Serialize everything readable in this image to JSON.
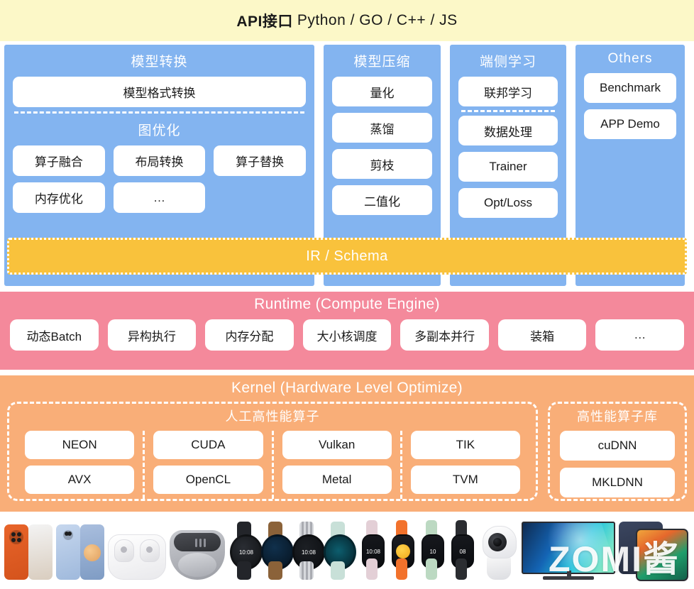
{
  "api_banner": {
    "bold_label": "API接口",
    "languages": "Python / GO / C++ / JS"
  },
  "frontend": {
    "columns": [
      {
        "title": "模型转换",
        "full_item": "模型格式转换",
        "sub_title": "图优化",
        "row1": [
          "算子融合",
          "布局转换",
          "算子替换"
        ],
        "row2": [
          "内存优化",
          "…"
        ]
      },
      {
        "title": "模型压缩",
        "items": [
          "量化",
          "蒸馏",
          "剪枝",
          "二值化"
        ]
      },
      {
        "title": "端侧学习",
        "top_item": "联邦学习",
        "items": [
          "数据处理",
          "Trainer",
          "Opt/Loss"
        ]
      },
      {
        "title": "Others",
        "items": [
          "Benchmark",
          "APP Demo"
        ]
      }
    ]
  },
  "ir_band": {
    "label": "IR / Schema"
  },
  "runtime": {
    "title": "Runtime (Compute Engine)",
    "items": [
      "动态Batch",
      "异构执行",
      "内存分配",
      "大小核调度",
      "多副本并行",
      "装箱",
      "…"
    ]
  },
  "kernel": {
    "title": "Kernel (Hardware Level Optimize)",
    "manual": {
      "title": "人工高性能算子",
      "groups": [
        [
          "NEON",
          "AVX"
        ],
        [
          "CUDA",
          "OpenCL"
        ],
        [
          "Vulkan",
          "Metal"
        ],
        [
          "TIK",
          "TVM"
        ]
      ]
    },
    "library": {
      "title": "高性能算子库",
      "items": [
        "cuDNN",
        "MKLDNN"
      ]
    }
  },
  "devices": {
    "labels": [
      "phone-orange",
      "phone-blue",
      "earbuds-white-case",
      "earbuds-gray-case",
      "smartwatch-black",
      "smartwatch-brown",
      "smartwatch-steel",
      "smartwatch-mint",
      "fitness-band-pink",
      "fitness-band-orange",
      "fitness-band-green",
      "fitness-band-black",
      "security-camera",
      "smart-tv",
      "tablet"
    ],
    "watch_time_1": "10:08",
    "watch_time_2": "10:08",
    "band_time_1": "10:08",
    "band_time_2": "10",
    "band_time_3": "08"
  },
  "watermark": {
    "text": "ZOMI酱"
  },
  "colors": {
    "banner_yellow": "#FCF8C8",
    "frontend_blue": "#83B4F0",
    "ir_yellow": "#F9C23C",
    "runtime_pink": "#F4899B",
    "kernel_orange": "#F9AE78",
    "pill_white": "#FFFFFF"
  }
}
